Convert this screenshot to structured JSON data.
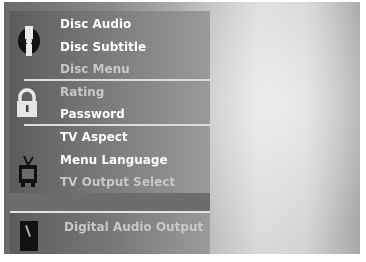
{
  "menu": {
    "disc_group": {
      "icon": "disc-icon",
      "items": [
        "Disc Audio",
        "Disc Subtitle",
        "Disc Menu"
      ]
    },
    "lock_group": {
      "icon": "lock-icon",
      "items": [
        "Rating",
        "Password"
      ]
    },
    "tv_group": {
      "icon": "tv-icon",
      "items": [
        "TV Aspect",
        "Menu Language",
        "TV Output Select"
      ]
    }
  },
  "audio_panel": {
    "icon": "speaker-icon",
    "label": "Digital Audio Output"
  },
  "colors": {
    "menu_text": "#ffffff",
    "menu_text_dim": "#c8c8c8",
    "divider": "#dcdcdc"
  }
}
